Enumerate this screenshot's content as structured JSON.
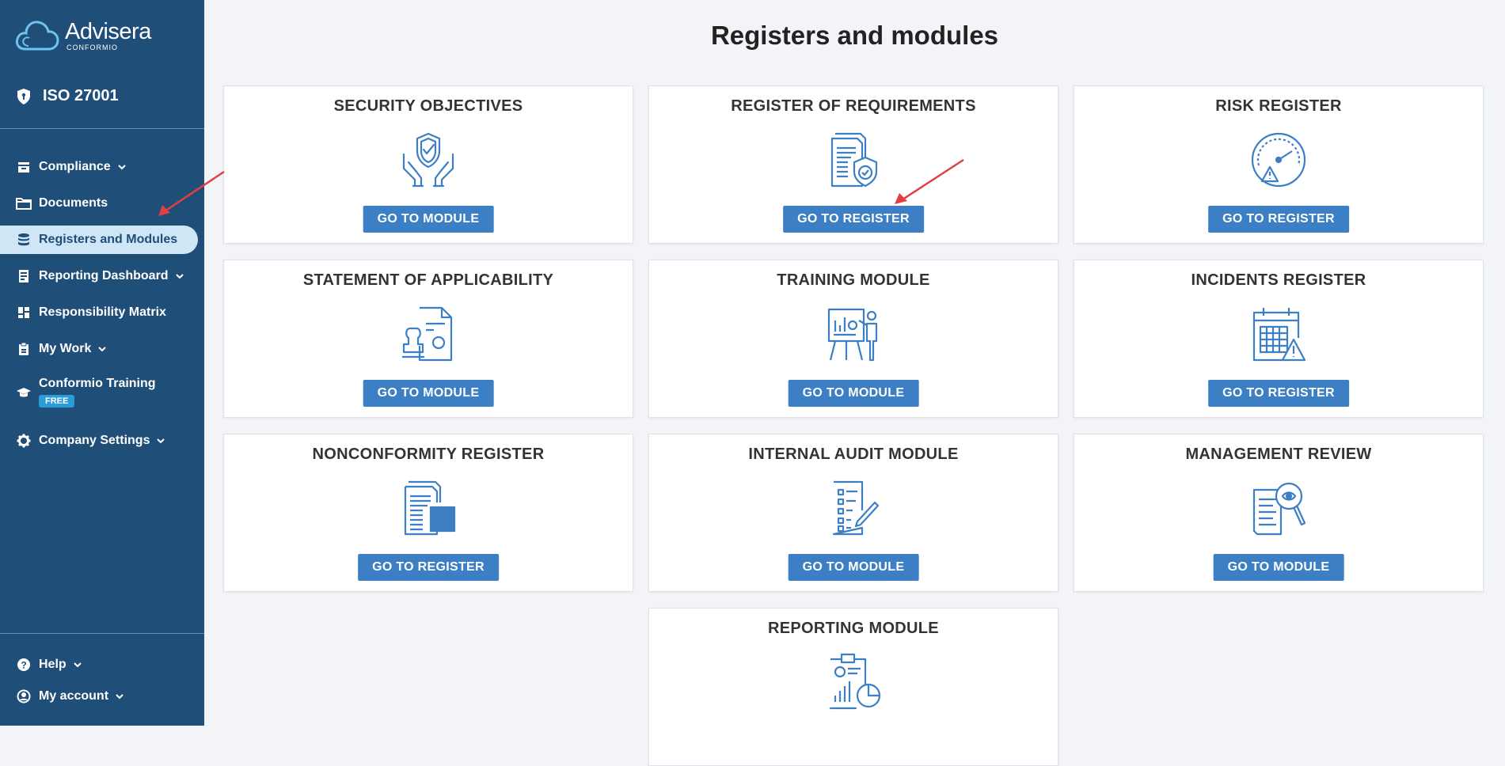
{
  "brand": {
    "name": "Advisera",
    "sub": "CONFORMIO"
  },
  "product": "ISO 27001",
  "sidebar": {
    "items": [
      {
        "label": "Compliance",
        "icon": "inbox-icon",
        "chevron": true
      },
      {
        "label": "Documents",
        "icon": "folder-icon",
        "chevron": false
      },
      {
        "label": "Registers and Modules",
        "icon": "database-icon",
        "chevron": false,
        "active": true
      },
      {
        "label": "Reporting Dashboard",
        "icon": "report-icon",
        "chevron": true
      },
      {
        "label": "Responsibility Matrix",
        "icon": "grid-icon",
        "chevron": false
      },
      {
        "label": "My Work",
        "icon": "clipboard-icon",
        "chevron": true
      },
      {
        "label": "Conformio Training",
        "icon": "graduation-cap-icon",
        "chevron": false,
        "badge": "FREE"
      },
      {
        "label": "Company Settings",
        "icon": "gear-icon",
        "chevron": true
      }
    ],
    "bottom": [
      {
        "label": "Help",
        "icon": "help-icon"
      },
      {
        "label": "My account",
        "icon": "account-icon"
      }
    ]
  },
  "main": {
    "title": "Registers and modules",
    "cards": [
      {
        "title": "SECURITY OBJECTIVES",
        "button": "GO TO MODULE",
        "icon": "shield-hands-icon"
      },
      {
        "title": "REGISTER OF REQUIREMENTS",
        "button": "GO TO REGISTER",
        "icon": "document-shield-icon"
      },
      {
        "title": "RISK REGISTER",
        "button": "GO TO REGISTER",
        "icon": "risk-gauge-icon"
      },
      {
        "title": "STATEMENT OF APPLICABILITY",
        "button": "GO TO MODULE",
        "icon": "stamp-document-icon"
      },
      {
        "title": "TRAINING MODULE",
        "button": "GO TO MODULE",
        "icon": "presentation-icon"
      },
      {
        "title": "INCIDENTS REGISTER",
        "button": "GO TO REGISTER",
        "icon": "calendar-warning-icon"
      },
      {
        "title": "NONCONFORMITY REGISTER",
        "button": "GO TO REGISTER",
        "icon": "documents-icon"
      },
      {
        "title": "INTERNAL AUDIT MODULE",
        "button": "GO TO MODULE",
        "icon": "checklist-icon"
      },
      {
        "title": "MANAGEMENT REVIEW",
        "button": "GO TO MODULE",
        "icon": "document-magnifier-icon"
      },
      {
        "title": "REPORTING MODULE",
        "button": "",
        "icon": "clipboard-chart-icon"
      }
    ]
  },
  "colors": {
    "sidebar": "#1f4e79",
    "button": "#3d7fc4",
    "icon": "#3d7fc4",
    "active_bg": "#cfe6f7",
    "arrow": "#e04040"
  }
}
